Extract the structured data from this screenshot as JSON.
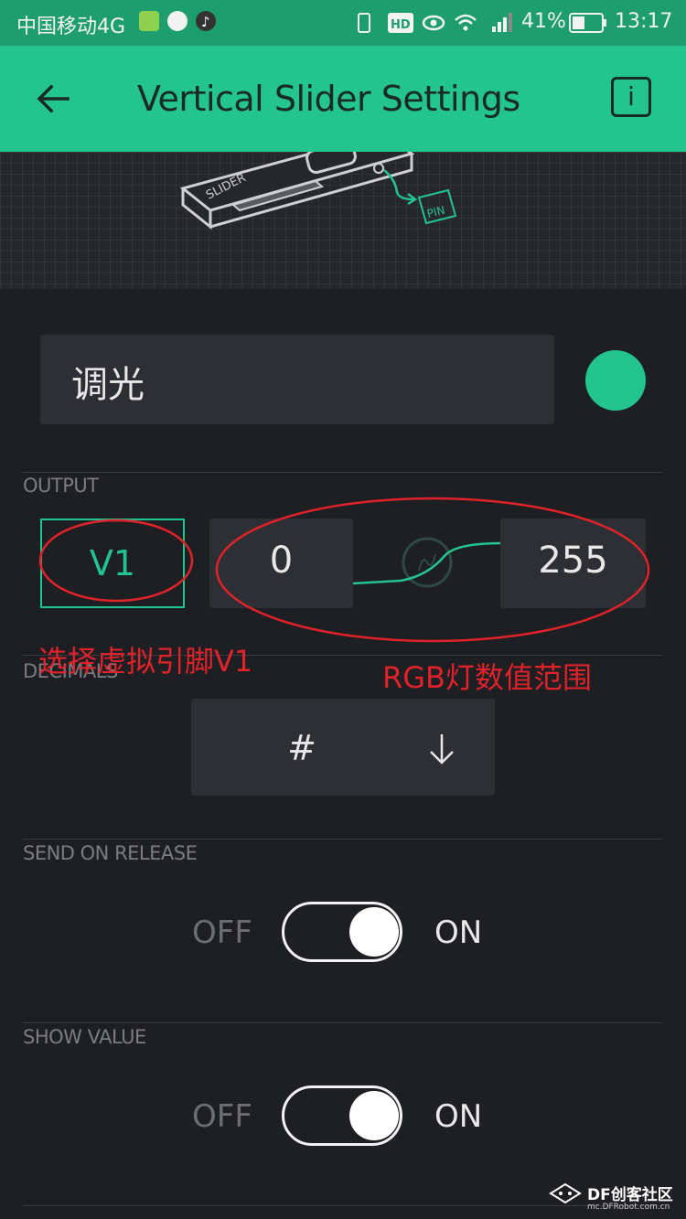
{
  "status_bar": {
    "carrier": "中国移动4G",
    "battery": "41%",
    "time": "13:17"
  },
  "app_bar": {
    "title": "Vertical Slider Settings",
    "info_label": "i"
  },
  "illustration": {
    "slider_label": "SLIDER",
    "pin_label": "PIN"
  },
  "name_field": {
    "value": "调光",
    "color": "#23c48e"
  },
  "output": {
    "section_label": "OUTPUT",
    "pin": "V1",
    "min": "0",
    "max": "255"
  },
  "decimals": {
    "section_label": "DECIMALS",
    "value": "#"
  },
  "send_on_release": {
    "section_label": "SEND ON RELEASE",
    "off_label": "OFF",
    "on_label": "ON",
    "state": "on"
  },
  "show_value": {
    "section_label": "SHOW VALUE",
    "off_label": "OFF",
    "on_label": "ON",
    "state": "on"
  },
  "annotations": {
    "pin_note": "选择虚拟引脚V1",
    "range_note": "RGB灯数值范围",
    "color": "#e0222a"
  },
  "watermark": {
    "brand": "DF创客社区",
    "url": "mc.DFRobot.com.cn"
  },
  "colors": {
    "accent": "#23c48e",
    "background": "#1e1f23",
    "field": "#2e2f34"
  }
}
